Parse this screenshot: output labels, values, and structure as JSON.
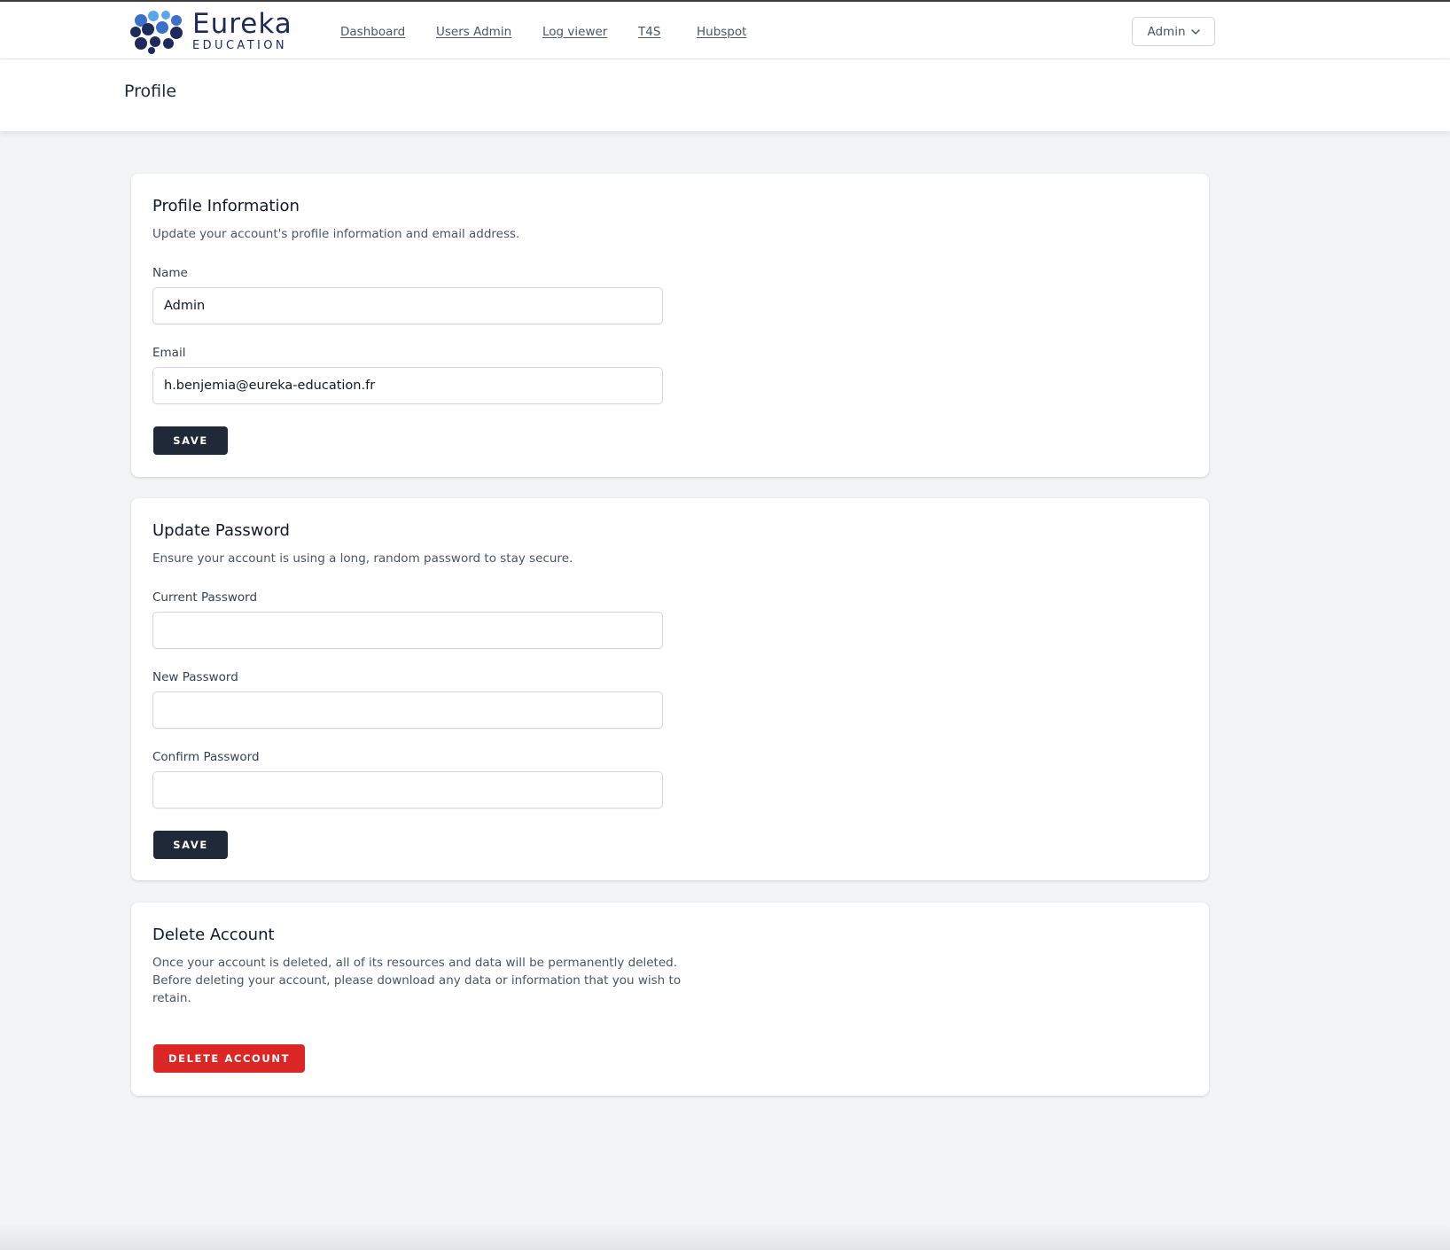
{
  "brand": {
    "name": "Eureka",
    "tagline": "EDUCATION",
    "colors": {
      "primary": "#1f2a5c",
      "secondary": "#3b6fc9",
      "accent": "#5aa6e6"
    }
  },
  "nav": {
    "items": [
      {
        "label": "Dashboard"
      },
      {
        "label": "Users Admin"
      },
      {
        "label": "Log viewer"
      },
      {
        "label": "T4S"
      },
      {
        "label": "Hubspot"
      }
    ],
    "user_menu": {
      "label": "Admin",
      "icon": "chevron-down-icon"
    }
  },
  "page": {
    "title": "Profile"
  },
  "profile_info": {
    "title": "Profile Information",
    "description": "Update your account's profile information and email address.",
    "name_label": "Name",
    "name_value": "Admin",
    "email_label": "Email",
    "email_value": "h.benjemia@eureka-education.fr",
    "save_label": "Save"
  },
  "update_password": {
    "title": "Update Password",
    "description": "Ensure your account is using a long, random password to stay secure.",
    "current_label": "Current Password",
    "current_value": "",
    "new_label": "New Password",
    "new_value": "",
    "confirm_label": "Confirm Password",
    "confirm_value": "",
    "save_label": "Save"
  },
  "delete_account": {
    "title": "Delete Account",
    "description_line1": "Once your account is deleted, all of its resources and data will be permanently deleted.",
    "description_line2": "Before deleting your account, please download any data or information that you wish to",
    "description_line3": "retain.",
    "button_label": "Delete Account"
  },
  "colors": {
    "page_bg": "#f3f4f6",
    "button_dark": "#1f2937",
    "button_danger": "#dc2626"
  }
}
